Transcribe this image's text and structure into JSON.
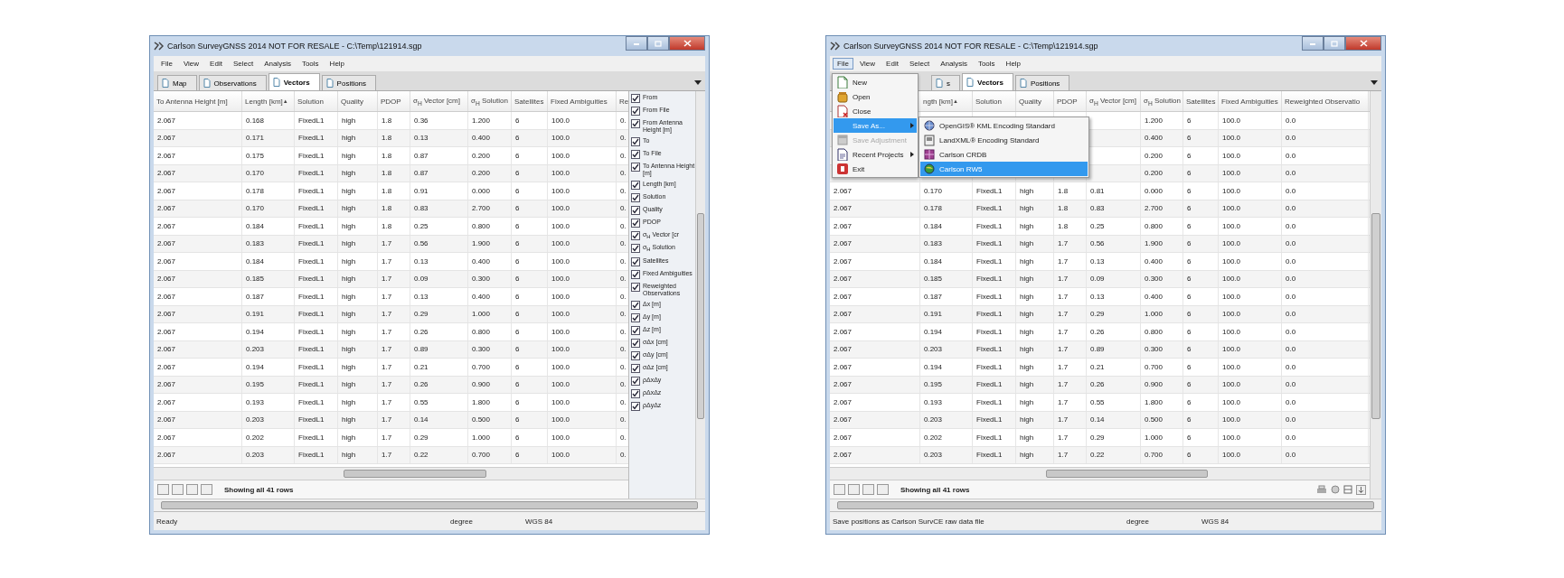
{
  "windows": [
    {
      "title": "Carlson SurveyGNSS 2014  NOT FOR RESALE - C:\\Temp\\121914.sgp",
      "menu": [
        {
          "label": "File",
          "open": false
        },
        {
          "label": "View",
          "open": false
        },
        {
          "label": "Edit",
          "open": false
        },
        {
          "label": "Select",
          "open": false
        },
        {
          "label": "Analysis",
          "open": false
        },
        {
          "label": "Tools",
          "open": false
        },
        {
          "label": "Help",
          "open": false
        }
      ],
      "tabs": [
        {
          "label": "Map",
          "selected": false
        },
        {
          "label": "Observations",
          "selected": false
        },
        {
          "label": "Vectors",
          "selected": true
        },
        {
          "label": "Positions",
          "selected": false
        }
      ],
      "columns": [
        {
          "label": "To Antenna Height [m]"
        },
        {
          "label": "Length [km]",
          "sort_mark": "▲"
        },
        {
          "label": "Solution"
        },
        {
          "label": "Quality"
        },
        {
          "label": "PDOP"
        },
        {
          "label": "σ$_{H}$ Vector [cm]"
        },
        {
          "label": "σ$_{H}$ Solution"
        },
        {
          "label": "Satellites"
        },
        {
          "label": "Fixed Ambiguities"
        },
        {
          "label": "Re"
        }
      ],
      "rows": [
        [
          "2.067",
          "0.168",
          "FixedL1",
          "high",
          "1.8",
          "0.36",
          "1.200",
          "6",
          "100.0",
          "0."
        ],
        [
          "2.067",
          "0.171",
          "FixedL1",
          "high",
          "1.8",
          "0.13",
          "0.400",
          "6",
          "100.0",
          "0."
        ],
        [
          "2.067",
          "0.175",
          "FixedL1",
          "high",
          "1.8",
          "0.87",
          "0.200",
          "6",
          "100.0",
          "0."
        ],
        [
          "2.067",
          "0.170",
          "FixedL1",
          "high",
          "1.8",
          "0.87",
          "0.200",
          "6",
          "100.0",
          "0."
        ],
        [
          "2.067",
          "0.178",
          "FixedL1",
          "high",
          "1.8",
          "0.91",
          "0.000",
          "6",
          "100.0",
          "0."
        ],
        [
          "2.067",
          "0.170",
          "FixedL1",
          "high",
          "1.8",
          "0.83",
          "2.700",
          "6",
          "100.0",
          "0."
        ],
        [
          "2.067",
          "0.184",
          "FixedL1",
          "high",
          "1.8",
          "0.25",
          "0.800",
          "6",
          "100.0",
          "0."
        ],
        [
          "2.067",
          "0.183",
          "FixedL1",
          "high",
          "1.7",
          "0.56",
          "1.900",
          "6",
          "100.0",
          "0."
        ],
        [
          "2.067",
          "0.184",
          "FixedL1",
          "high",
          "1.7",
          "0.13",
          "0.400",
          "6",
          "100.0",
          "0."
        ],
        [
          "2.067",
          "0.185",
          "FixedL1",
          "high",
          "1.7",
          "0.09",
          "0.300",
          "6",
          "100.0",
          "0."
        ],
        [
          "2.067",
          "0.187",
          "FixedL1",
          "high",
          "1.7",
          "0.13",
          "0.400",
          "6",
          "100.0",
          "0."
        ],
        [
          "2.067",
          "0.191",
          "FixedL1",
          "high",
          "1.7",
          "0.29",
          "1.000",
          "6",
          "100.0",
          "0."
        ],
        [
          "2.067",
          "0.194",
          "FixedL1",
          "high",
          "1.7",
          "0.26",
          "0.800",
          "6",
          "100.0",
          "0."
        ],
        [
          "2.067",
          "0.203",
          "FixedL1",
          "high",
          "1.7",
          "0.89",
          "0.300",
          "6",
          "100.0",
          "0."
        ],
        [
          "2.067",
          "0.194",
          "FixedL1",
          "high",
          "1.7",
          "0.21",
          "0.700",
          "6",
          "100.0",
          "0."
        ],
        [
          "2.067",
          "0.195",
          "FixedL1",
          "high",
          "1.7",
          "0.26",
          "0.900",
          "6",
          "100.0",
          "0."
        ],
        [
          "2.067",
          "0.193",
          "FixedL1",
          "high",
          "1.7",
          "0.55",
          "1.800",
          "6",
          "100.0",
          "0."
        ],
        [
          "2.067",
          "0.203",
          "FixedL1",
          "high",
          "1.7",
          "0.14",
          "0.500",
          "6",
          "100.0",
          "0."
        ],
        [
          "2.067",
          "0.202",
          "FixedL1",
          "high",
          "1.7",
          "0.29",
          "1.000",
          "6",
          "100.0",
          "0."
        ],
        [
          "2.067",
          "0.203",
          "FixedL1",
          "high",
          "1.7",
          "0.22",
          "0.700",
          "6",
          "100.0",
          "0."
        ]
      ],
      "column_chooser": [
        {
          "label": "From",
          "checked": true
        },
        {
          "label": "From File",
          "checked": true
        },
        {
          "label": "From Antenna Height [m]",
          "checked": true
        },
        {
          "label": "To",
          "checked": true
        },
        {
          "label": "To File",
          "checked": true
        },
        {
          "label": "To Antenna Height [m]",
          "checked": true
        },
        {
          "label": "Length [km]",
          "checked": true
        },
        {
          "label": "Solution",
          "checked": true
        },
        {
          "label": "Quality",
          "checked": true
        },
        {
          "label": "PDOP",
          "checked": true
        },
        {
          "label": "σ$_{H}$ Vector [cr",
          "checked": true
        },
        {
          "label": "σ$_{H}$ Solution",
          "checked": true
        },
        {
          "label": "Satellites",
          "checked": true
        },
        {
          "label": "Fixed Ambiguities",
          "checked": true
        },
        {
          "label": "Reweighted Observations",
          "checked": true
        },
        {
          "label": "Δx [m]",
          "checked": true
        },
        {
          "label": "Δy [m]",
          "checked": true
        },
        {
          "label": "Δz [m]",
          "checked": true
        },
        {
          "label": "σΔx [cm]",
          "checked": true
        },
        {
          "label": "σΔy [cm]",
          "checked": true
        },
        {
          "label": "σΔz [cm]",
          "checked": true
        },
        {
          "label": "ρΔxΔy",
          "checked": true
        },
        {
          "label": "ρΔxΔz",
          "checked": true
        },
        {
          "label": "ρΔyΔz",
          "checked": true
        }
      ],
      "pager_text": "Showing all 41 rows",
      "status": [
        "Ready",
        "degree",
        "WGS 84"
      ]
    },
    {
      "title": "Carlson SurveyGNSS 2014  NOT FOR RESALE - C:\\Temp\\121914.sgp",
      "menu": [
        {
          "label": "File",
          "open": true
        },
        {
          "label": "View",
          "open": false
        },
        {
          "label": "Edit",
          "open": false
        },
        {
          "label": "Select",
          "open": false
        },
        {
          "label": "Analysis",
          "open": false
        },
        {
          "label": "Tools",
          "open": false
        },
        {
          "label": "Help",
          "open": false
        }
      ],
      "tabs": [
        {
          "label": "s",
          "selected": false
        },
        {
          "label": "Vectors",
          "selected": true
        },
        {
          "label": "Positions",
          "selected": false
        }
      ],
      "columns": [
        null,
        {
          "label": "ngth [km]",
          "sort_mark": "▲"
        },
        {
          "label": "Solution"
        },
        {
          "label": "Quality"
        },
        {
          "label": "PDOP"
        },
        {
          "label": "σ$_{H}$ Vector [cm]"
        },
        {
          "label": "σ$_{H}$ Solution"
        },
        {
          "label": "Satellites"
        },
        {
          "label": "Fixed Ambiguities"
        },
        {
          "label": "Reweighted Observatio"
        }
      ],
      "rows": [
        [
          null,
          null,
          null,
          null,
          null,
          null,
          "1.200",
          "6",
          "100.0",
          "0.0"
        ],
        [
          null,
          null,
          null,
          null,
          null,
          null,
          "0.400",
          "6",
          "100.0",
          "0.0"
        ],
        [
          null,
          null,
          null,
          null,
          null,
          null,
          "0.200",
          "6",
          "100.0",
          "0.0"
        ],
        [
          null,
          null,
          null,
          null,
          null,
          null,
          "0.200",
          "6",
          "100.0",
          "0.0"
        ],
        [
          "2.067",
          "0.170",
          "FixedL1",
          "high",
          "1.8",
          "0.81",
          "0.000",
          "6",
          "100.0",
          "0.0"
        ],
        [
          "2.067",
          "0.178",
          "FixedL1",
          "high",
          "1.8",
          "0.83",
          "2.700",
          "6",
          "100.0",
          "0.0"
        ],
        [
          "2.067",
          "0.184",
          "FixedL1",
          "high",
          "1.8",
          "0.25",
          "0.800",
          "6",
          "100.0",
          "0.0"
        ],
        [
          "2.067",
          "0.183",
          "FixedL1",
          "high",
          "1.7",
          "0.56",
          "1.900",
          "6",
          "100.0",
          "0.0"
        ],
        [
          "2.067",
          "0.184",
          "FixedL1",
          "high",
          "1.7",
          "0.13",
          "0.400",
          "6",
          "100.0",
          "0.0"
        ],
        [
          "2.067",
          "0.185",
          "FixedL1",
          "high",
          "1.7",
          "0.09",
          "0.300",
          "6",
          "100.0",
          "0.0"
        ],
        [
          "2.067",
          "0.187",
          "FixedL1",
          "high",
          "1.7",
          "0.13",
          "0.400",
          "6",
          "100.0",
          "0.0"
        ],
        [
          "2.067",
          "0.191",
          "FixedL1",
          "high",
          "1.7",
          "0.29",
          "1.000",
          "6",
          "100.0",
          "0.0"
        ],
        [
          "2.067",
          "0.194",
          "FixedL1",
          "high",
          "1.7",
          "0.26",
          "0.800",
          "6",
          "100.0",
          "0.0"
        ],
        [
          "2.067",
          "0.203",
          "FixedL1",
          "high",
          "1.7",
          "0.89",
          "0.300",
          "6",
          "100.0",
          "0.0"
        ],
        [
          "2.067",
          "0.194",
          "FixedL1",
          "high",
          "1.7",
          "0.21",
          "0.700",
          "6",
          "100.0",
          "0.0"
        ],
        [
          "2.067",
          "0.195",
          "FixedL1",
          "high",
          "1.7",
          "0.26",
          "0.900",
          "6",
          "100.0",
          "0.0"
        ],
        [
          "2.067",
          "0.193",
          "FixedL1",
          "high",
          "1.7",
          "0.55",
          "1.800",
          "6",
          "100.0",
          "0.0"
        ],
        [
          "2.067",
          "0.203",
          "FixedL1",
          "high",
          "1.7",
          "0.14",
          "0.500",
          "6",
          "100.0",
          "0.0"
        ],
        [
          "2.067",
          "0.202",
          "FixedL1",
          "high",
          "1.7",
          "0.29",
          "1.000",
          "6",
          "100.0",
          "0.0"
        ],
        [
          "2.067",
          "0.203",
          "FixedL1",
          "high",
          "1.7",
          "0.22",
          "0.700",
          "6",
          "100.0",
          "0.0"
        ]
      ],
      "file_menu": {
        "items": [
          {
            "label": "New",
            "kind": "new",
            "selected": false,
            "disabled": false,
            "submenu": false
          },
          {
            "label": "Open",
            "kind": "open",
            "selected": false,
            "disabled": false,
            "submenu": false
          },
          {
            "label": "Close",
            "kind": "close",
            "selected": false,
            "disabled": false,
            "submenu": false
          },
          {
            "label": "Save As...",
            "kind": "plain",
            "selected": true,
            "disabled": false,
            "submenu": true
          },
          {
            "label": "Save Adjustment",
            "kind": "adjust",
            "selected": false,
            "disabled": true,
            "submenu": false
          },
          {
            "label": "Recent Projects",
            "kind": "recent",
            "selected": false,
            "disabled": false,
            "submenu": true
          },
          {
            "label": "Exit",
            "kind": "exit",
            "selected": false,
            "disabled": false,
            "submenu": false
          }
        ],
        "submenu_items": [
          {
            "label": "OpenGIS® KML Encoding Standard",
            "kind": "globe",
            "selected": false
          },
          {
            "label": "LandXML® Encoding Standard",
            "kind": "xml",
            "selected": false
          },
          {
            "label": "Carlson CRDB",
            "kind": "crdb",
            "selected": false
          },
          {
            "label": "Carlson RW5",
            "kind": "rw5",
            "selected": true
          }
        ]
      },
      "pager_text": "Showing all 41 rows",
      "export_buttons": true,
      "status": [
        "Save positions as Carlson SurvCE raw data file",
        "degree",
        "WGS 84"
      ]
    }
  ]
}
